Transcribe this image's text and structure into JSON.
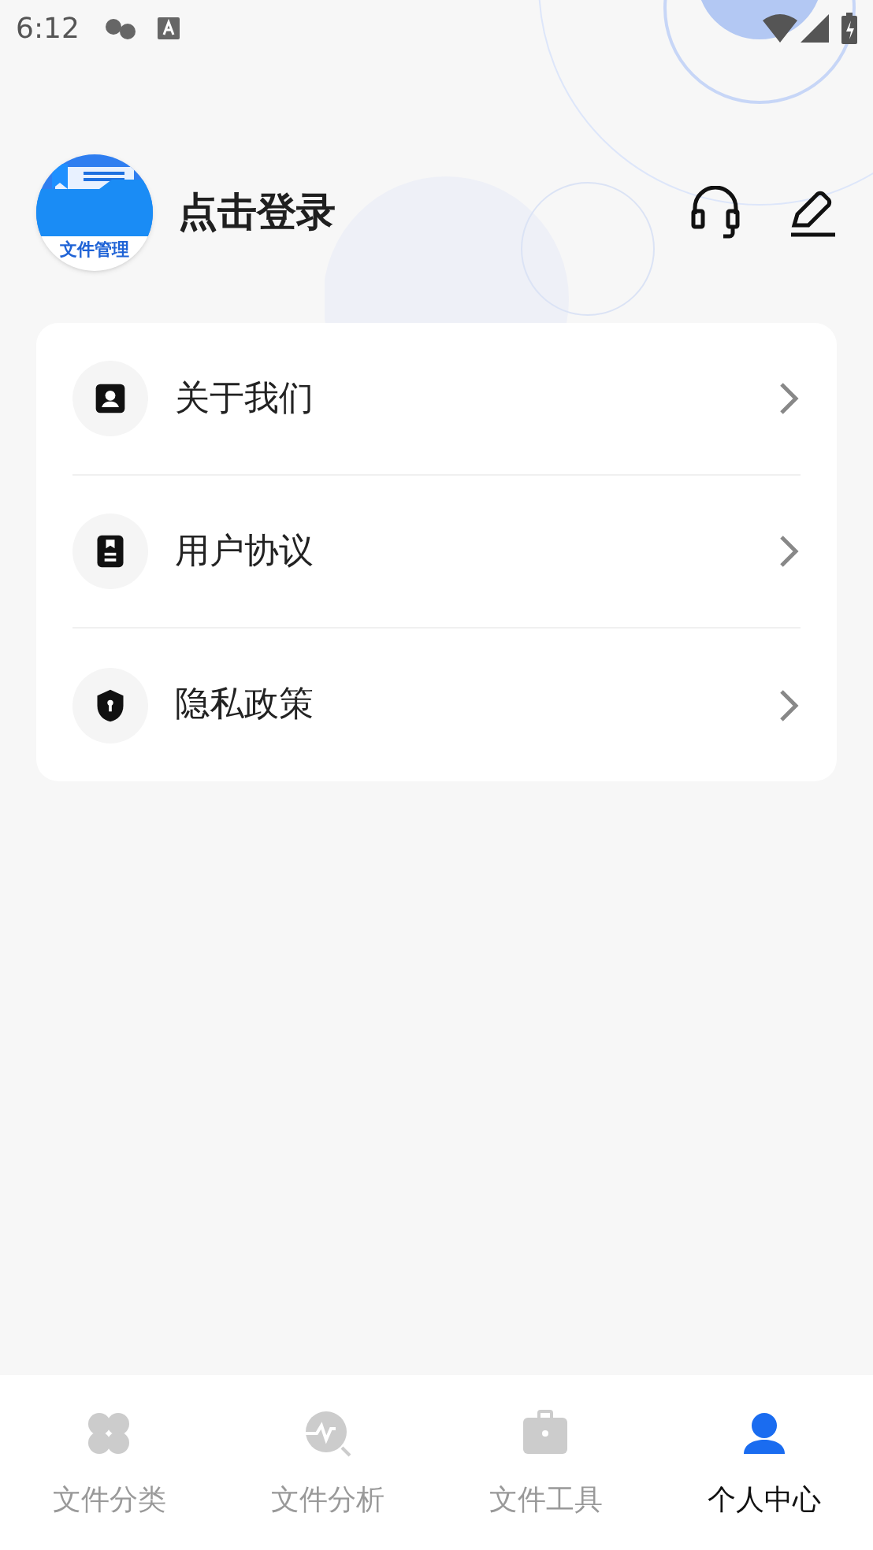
{
  "status_bar": {
    "time": "6:12"
  },
  "profile": {
    "logo_text": "文件管理",
    "login_label": "点击登录"
  },
  "menu": [
    {
      "label": "关于我们"
    },
    {
      "label": "用户协议"
    },
    {
      "label": "隐私政策"
    }
  ],
  "tabs": [
    {
      "label": "文件分类",
      "selected": false
    },
    {
      "label": "文件分析",
      "selected": false
    },
    {
      "label": "文件工具",
      "selected": false
    },
    {
      "label": "个人中心",
      "selected": true
    }
  ]
}
